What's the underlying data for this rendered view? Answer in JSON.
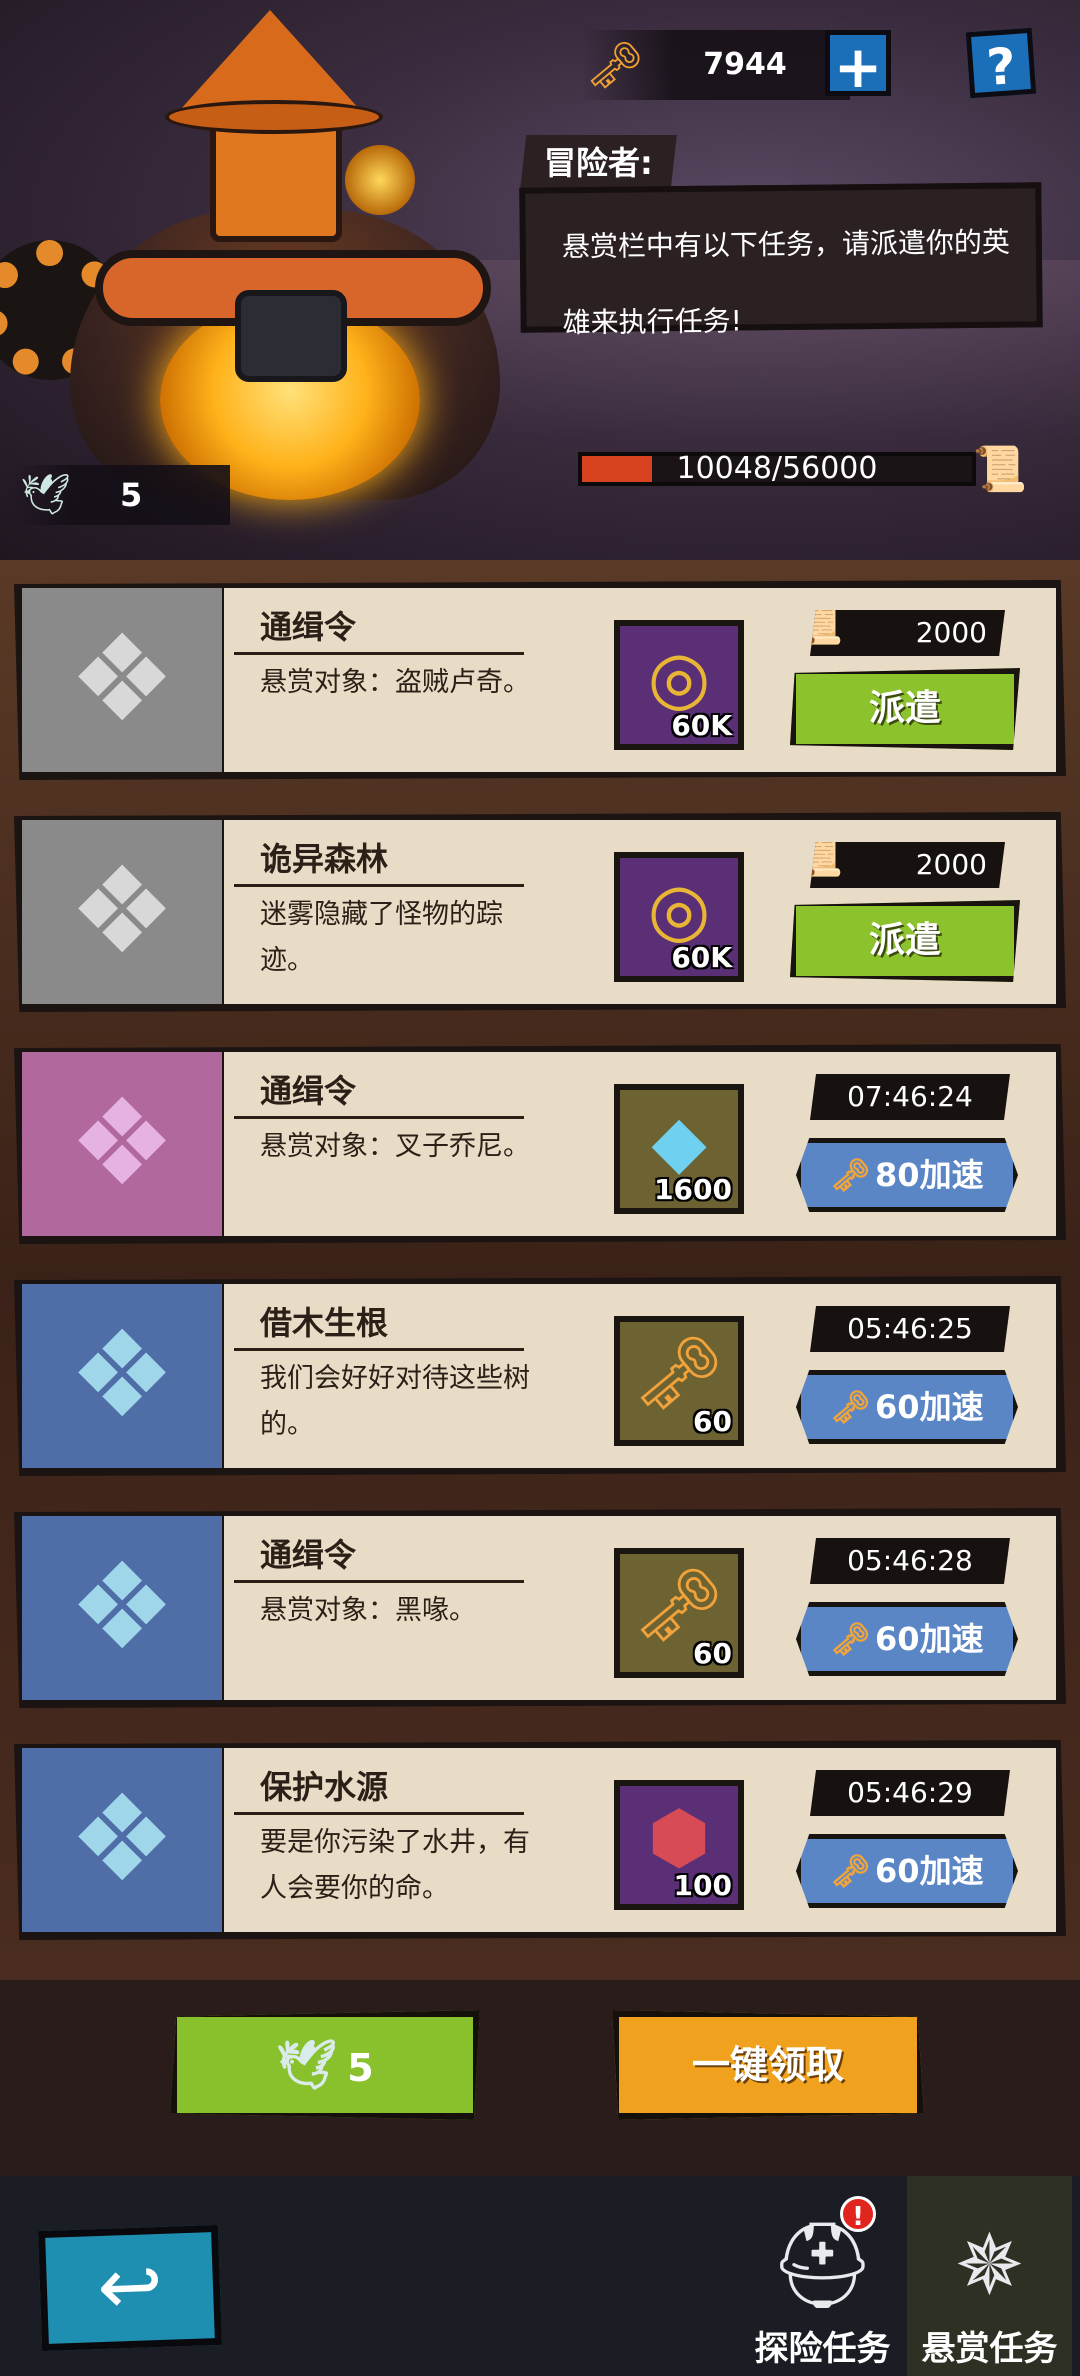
{
  "header": {
    "currency": {
      "icon": "scroll-key-icon",
      "amount": "7944"
    },
    "plus_label": "+",
    "help_label": "?",
    "speaker": "冒险者:",
    "dialog_text": "悬赏栏中有以下任务，请派遣你的英雄来执行任务!",
    "progress": {
      "label": "10048/56000",
      "fraction": 0.1794
    },
    "ticket_count": "5"
  },
  "quests": [
    {
      "title": "通缉令",
      "desc": "悬赏对象：盗贼卢奇。",
      "rarity": "gray",
      "reward_icon": "gold-coin-icon",
      "reward_value": "60K",
      "reward_frame": "purple",
      "state": "dispatch",
      "cost": "2000",
      "action_label": "派遣"
    },
    {
      "title": "诡异森林",
      "desc": "迷雾隐藏了怪物的踪迹。",
      "rarity": "gray",
      "reward_icon": "gold-coin-icon",
      "reward_value": "60K",
      "reward_frame": "purple",
      "state": "dispatch",
      "cost": "2000",
      "action_label": "派遣"
    },
    {
      "title": "通缉令",
      "desc": "悬赏对象：叉子乔尼。",
      "rarity": "purple",
      "reward_icon": "blue-crystal-icon",
      "reward_value": "1600",
      "reward_frame": "gold",
      "state": "timer",
      "timer": "07:46:24",
      "speed_label": "80加速"
    },
    {
      "title": "借木生根",
      "desc": "我们会好好对待这些树的。",
      "rarity": "blue",
      "reward_icon": "scroll-key-icon",
      "reward_value": "60",
      "reward_frame": "gold",
      "state": "timer",
      "timer": "05:46:25",
      "speed_label": "60加速"
    },
    {
      "title": "通缉令",
      "desc": "悬赏对象：黑喙。",
      "rarity": "blue",
      "reward_icon": "scroll-key-icon",
      "reward_value": "60",
      "reward_frame": "gold",
      "state": "timer",
      "timer": "05:46:28",
      "speed_label": "60加速"
    },
    {
      "title": "保护水源",
      "desc": "要是你污染了水井，有人会要你的命。",
      "rarity": "blue",
      "reward_icon": "red-gem-icon",
      "reward_value": "100",
      "reward_frame": "purple",
      "state": "timer",
      "timer": "05:46:29",
      "speed_label": "60加速"
    }
  ],
  "actions": {
    "ticket_button_value": "5",
    "claim_all_label": "一键领取"
  },
  "nav": {
    "back_icon": "back-arrow-icon",
    "tabs": [
      {
        "label": "探险任务",
        "icon": "helmet-icon",
        "badge": "!"
      },
      {
        "label": "悬赏任务",
        "icon": "compass-emblem-icon"
      }
    ]
  },
  "colors": {
    "dispatch_green": "#8cc22c",
    "claim_orange": "#f0a21e",
    "speed_blue": "#5b86c6",
    "progress_red": "#d6431e"
  }
}
